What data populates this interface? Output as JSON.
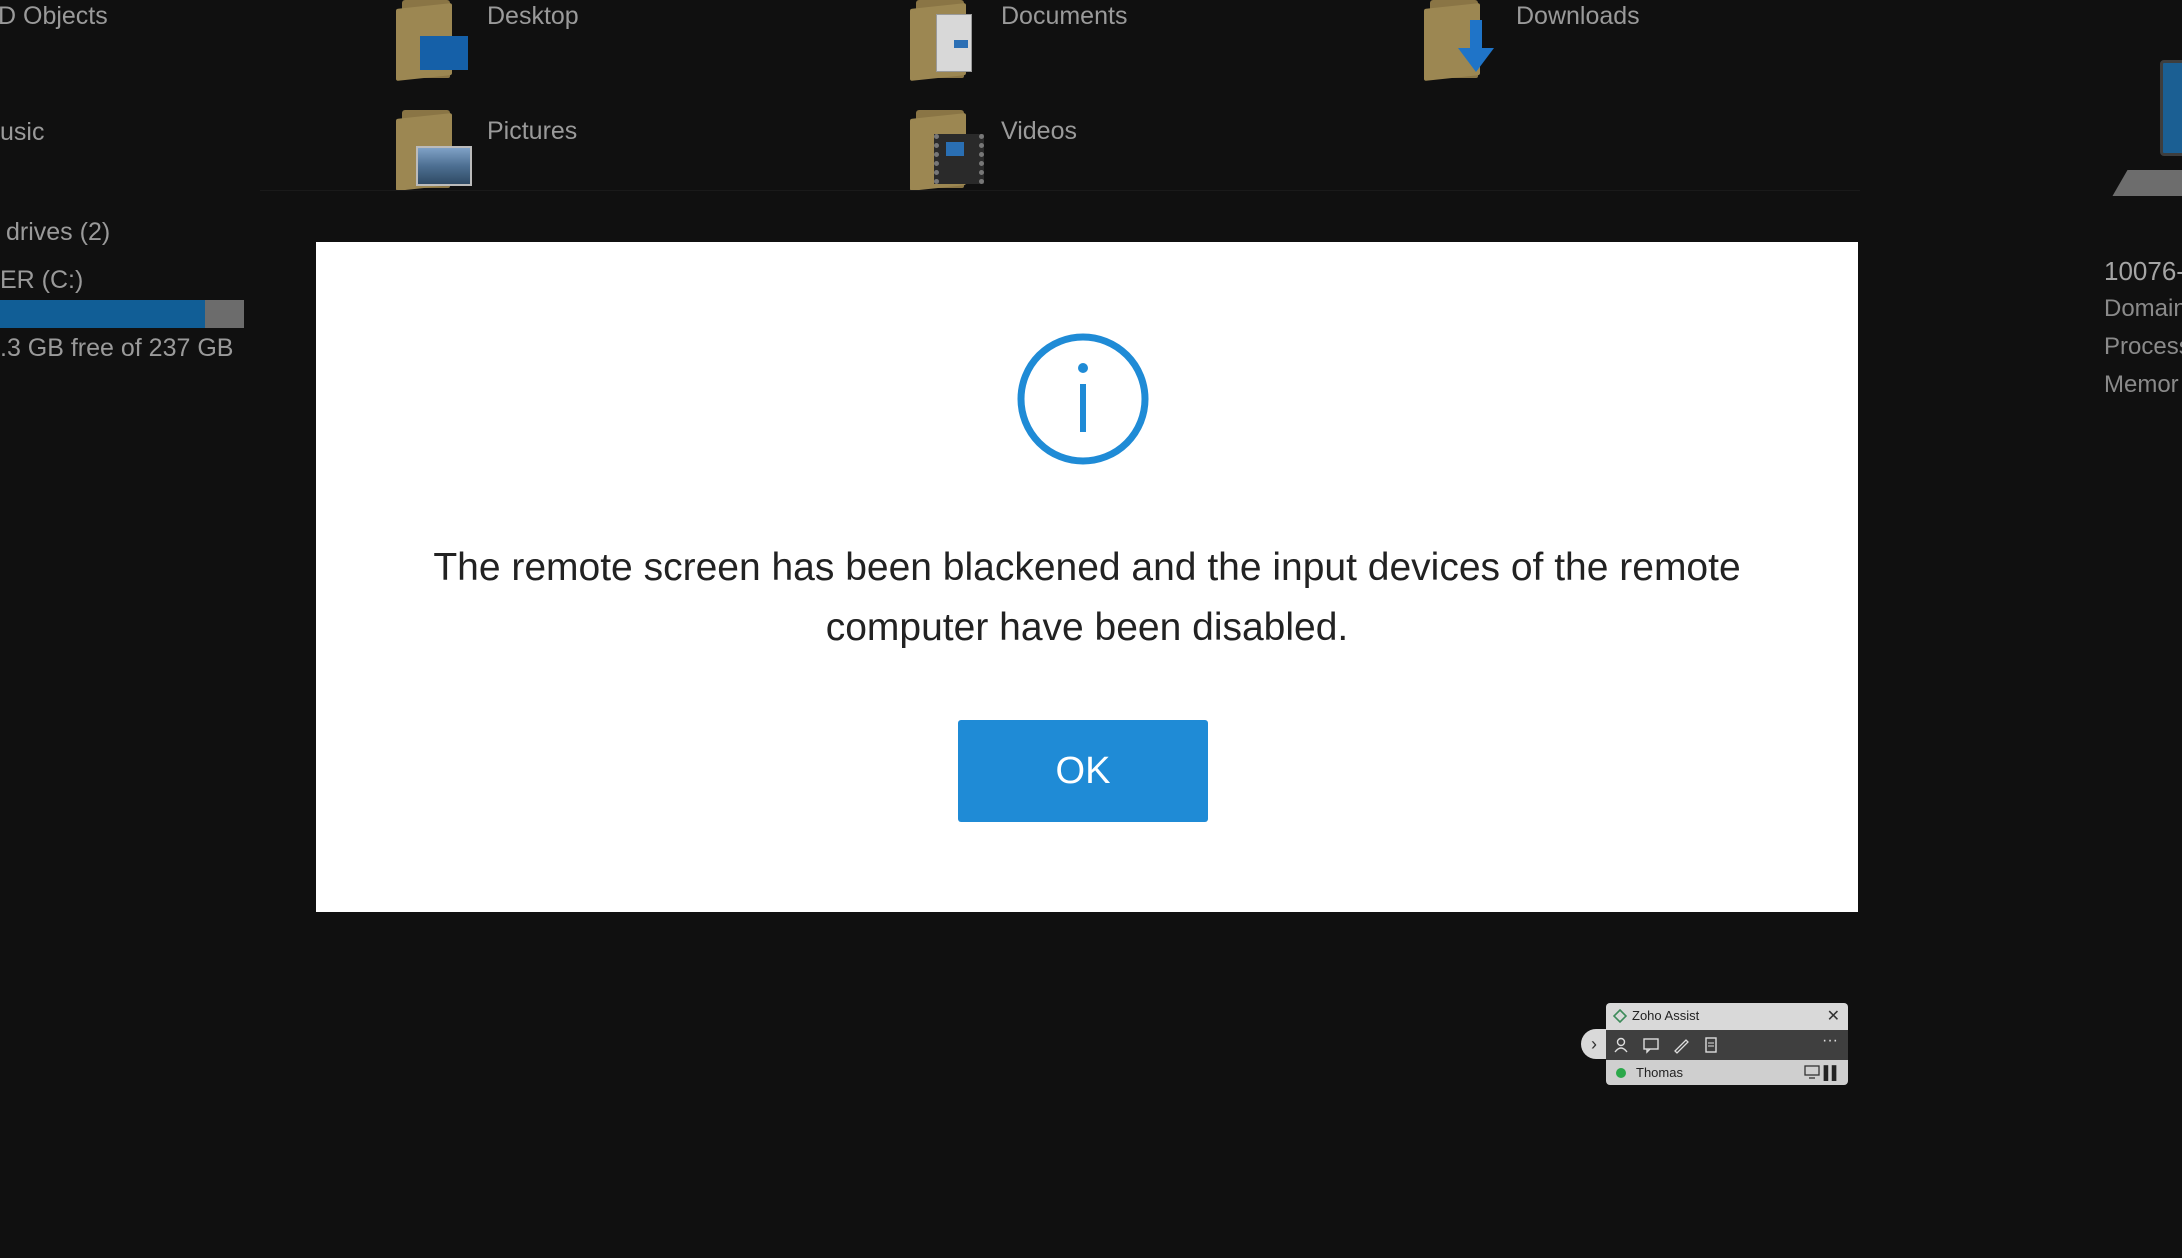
{
  "explorer": {
    "sidebar": {
      "objects_label": "D Objects",
      "music_label": "usic",
      "drives_header": "drives (2)",
      "drive_name": "ER (C:)",
      "drive_free_text": ".3 GB free of 237 GB",
      "drive_used_fraction": 0.84
    },
    "folders": [
      {
        "label": "Desktop",
        "icon": "desktop-folder-icon"
      },
      {
        "label": "Documents",
        "icon": "documents-folder-icon"
      },
      {
        "label": "Downloads",
        "icon": "downloads-folder-icon"
      },
      {
        "label": "Pictures",
        "icon": "pictures-folder-icon"
      },
      {
        "label": "Videos",
        "icon": "videos-folder-icon"
      }
    ],
    "system_info": {
      "computer_name": "10076-",
      "domain_label": "Domain",
      "processor_label": "Process",
      "memory_label": "Memor"
    }
  },
  "dialog": {
    "icon": "info-icon",
    "accent_color": "#1f8bd6",
    "message": "The remote screen has been blackened and the input devices of the remote computer have been disabled.",
    "ok_label": "OK"
  },
  "zoho_toolbar": {
    "title": "Zoho Assist",
    "user_name": "Thomas",
    "user_status_color": "#2ba84a"
  }
}
